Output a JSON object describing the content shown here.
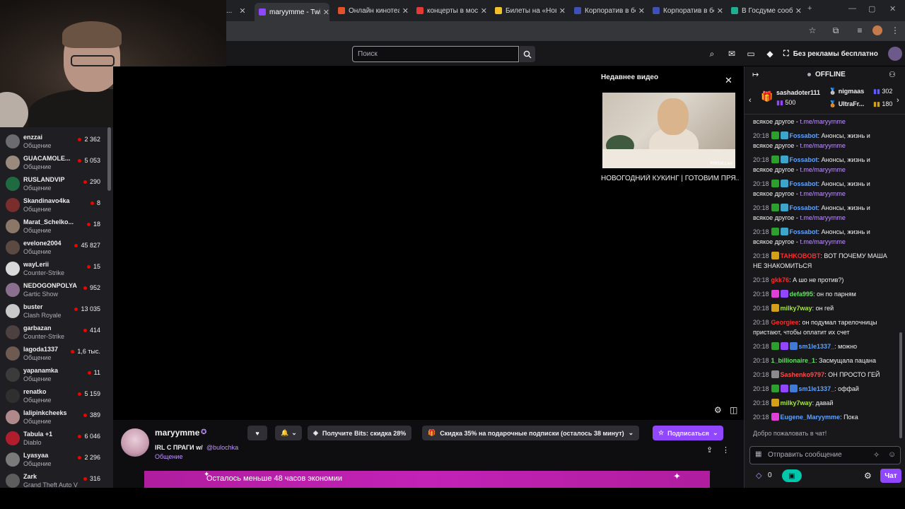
{
  "browser": {
    "tabs": [
      {
        "label": "...",
        "color": "#6f6f6f",
        "active": false
      },
      {
        "label": "maryymme - Twitch",
        "color": "#9147ff",
        "active": true
      },
      {
        "label": "Онлайн кинотеатр",
        "color": "#e2512a",
        "active": false
      },
      {
        "label": "концерты в моск",
        "color": "#e53935",
        "active": false
      },
      {
        "label": "Билеты на «Нова",
        "color": "#f2c029",
        "active": false
      },
      {
        "label": "Корпоратив в бе",
        "color": "#3f51b5",
        "active": false
      },
      {
        "label": "Корпоратив в бе",
        "color": "#3f51b5",
        "active": false
      },
      {
        "label": "В Госдуме сообщ",
        "color": "#1fae8f",
        "active": false
      }
    ],
    "new_tab": "+",
    "window_buttons": [
      "—",
      "▢",
      "✕"
    ]
  },
  "twitch_top": {
    "search_placeholder": "Поиск",
    "no_ads": "Без рекламы бесплатно"
  },
  "sidebar": {
    "channels": [
      {
        "name": "enzzai",
        "category": "Общение",
        "viewers": "2 362",
        "color": "#6b6b70"
      },
      {
        "name": "GUACAMOLE...",
        "category": "Общение",
        "viewers": "5 053",
        "color": "#9a8a7d"
      },
      {
        "name": "RUSLANDVIP",
        "category": "Общение",
        "viewers": "290",
        "color": "#1f6b41"
      },
      {
        "name": "Skandinavo4ka",
        "category": "Общение",
        "viewers": "8",
        "color": "#7a2d2d"
      },
      {
        "name": "Marat_Schelko...",
        "category": "Общение",
        "viewers": "18",
        "color": "#8a7768"
      },
      {
        "name": "evelone2004",
        "category": "Общение",
        "viewers": "45 827",
        "color": "#5a4a42"
      },
      {
        "name": "wayLerii",
        "category": "Counter-Strike",
        "viewers": "15",
        "color": "#d9d9d9"
      },
      {
        "name": "NEDOGONPOLYA",
        "category": "Gartic Show",
        "viewers": "952",
        "color": "#8a6f8f"
      },
      {
        "name": "buster",
        "category": "Clash Royale",
        "viewers": "13 035",
        "color": "#c9c9c9"
      },
      {
        "name": "garbazan",
        "category": "Counter-Strike",
        "viewers": "414",
        "color": "#4c4040"
      },
      {
        "name": "lagoda1337",
        "category": "Общение",
        "viewers": "1,6 тыс.",
        "color": "#6d5a50"
      },
      {
        "name": "yapanamka",
        "category": "Общение",
        "viewers": "11",
        "color": "#3b3b3b"
      },
      {
        "name": "renatko",
        "category": "Общение",
        "viewers": "5 159",
        "color": "#2f2f2f"
      },
      {
        "name": "lalipinkcheeks",
        "category": "Общение",
        "viewers": "389",
        "color": "#b08a8a"
      },
      {
        "name": "Tabula +1",
        "category": "Diablo",
        "viewers": "6 046",
        "color": "#b01d2d"
      },
      {
        "name": "Lyasyaa",
        "category": "Общение",
        "viewers": "2 296",
        "color": "#7a7a7a"
      },
      {
        "name": "Zark",
        "category": "Grand Theft Auto V",
        "viewers": "316",
        "color": "#5d5d5d"
      }
    ]
  },
  "recent": {
    "title": "Недавнее видео",
    "caption": "НОВОГОДНИЙ КУКИНГ | ГОТОВИМ ПРЯ...",
    "thumb_tag": "PRISM Live"
  },
  "channel": {
    "name": "maryymme",
    "title": "IRL С ПРАГИ w/",
    "mention": "@bulochka",
    "category": "Общение",
    "bits": "Получите Bits: скидка 28%",
    "gift": "Скидка 35% на подарочные подписки (осталось 38 минут)",
    "subscribe": "Подписаться",
    "promo": "Осталось меньше 48 часов экономии"
  },
  "chat": {
    "status": "OFFLINE",
    "gifter_name": "sashadoter111",
    "gifter_count": "500",
    "top1_name": "nigmaas",
    "top1_val": "302",
    "top2_name": "UltraFr...",
    "top2_val": "180",
    "messages": [
      {
        "ts": "",
        "user": "",
        "color": "#efeff1",
        "text": "всякое другое - ",
        "link": "t.me/maryymme",
        "badges": []
      },
      {
        "ts": "20:18",
        "user": "Fossabot",
        "color": "#5fa3ff",
        "text": ": Анонсы, жизнь и всякое другое - ",
        "link": "t.me/maryymme",
        "badges": [
          "#2ca02c",
          "#3fa4c9"
        ]
      },
      {
        "ts": "20:18",
        "user": "Fossabot",
        "color": "#5fa3ff",
        "text": ": Анонсы, жизнь и всякое другое - ",
        "link": "t.me/maryymme",
        "badges": [
          "#2ca02c",
          "#3fa4c9"
        ]
      },
      {
        "ts": "20:18",
        "user": "Fossabot",
        "color": "#5fa3ff",
        "text": ": Анонсы, жизнь и всякое другое - ",
        "link": "t.me/maryymme",
        "badges": [
          "#2ca02c",
          "#3fa4c9"
        ]
      },
      {
        "ts": "20:18",
        "user": "Fossabot",
        "color": "#5fa3ff",
        "text": ": Анонсы, жизнь и всякое другое - ",
        "link": "t.me/maryymme",
        "badges": [
          "#2ca02c",
          "#3fa4c9"
        ]
      },
      {
        "ts": "20:18",
        "user": "Fossabot",
        "color": "#5fa3ff",
        "text": ": Анонсы, жизнь и всякое другое - ",
        "link": "t.me/maryymme",
        "badges": [
          "#2ca02c",
          "#3fa4c9"
        ]
      },
      {
        "ts": "20:18",
        "user": "TAHKOBOBT",
        "color": "#ff2b2b",
        "text": ": ВОТ ПОЧЕМУ МАША НЕ ЗНАКОМИТЬСЯ",
        "link": "",
        "badges": [
          "#d4a017"
        ]
      },
      {
        "ts": "20:18",
        "user": "gkk76",
        "color": "#ff2b2b",
        "text": ": А шо не против?)",
        "link": "",
        "badges": []
      },
      {
        "ts": "20:18",
        "user": "defa995",
        "color": "#5fe35f",
        "text": ": он по парням",
        "link": "",
        "badges": [
          "#e03fd8",
          "#9147ff"
        ]
      },
      {
        "ts": "20:18",
        "user": "milky7way",
        "color": "#a8e34a",
        "text": ": он гей",
        "link": "",
        "badges": [
          "#d4a017"
        ]
      },
      {
        "ts": "20:18",
        "user": "Georgiee",
        "color": "#ff2b2b",
        "text": ": он подумал тарелочницы пристают, чтобы оплатит их счет",
        "link": "",
        "badges": []
      },
      {
        "ts": "20:18",
        "user": "sm1le1337_",
        "color": "#5fa3ff",
        "text": ": можно",
        "link": "",
        "badges": [
          "#2ca02c",
          "#9147ff",
          "#3f7bd6"
        ]
      },
      {
        "ts": "20:18",
        "user": "1_billionaire_1",
        "color": "#5fe35f",
        "text": ": Засмущала пацана",
        "link": "",
        "badges": []
      },
      {
        "ts": "20:18",
        "user": "Sashenko9797",
        "color": "#ff4a4a",
        "text": ": ОН ПРОСТО ГЕЙ",
        "link": "",
        "badges": [
          "#8a8a8a"
        ]
      },
      {
        "ts": "20:18",
        "user": "sm1le1337_",
        "color": "#5fa3ff",
        "text": ": оффай",
        "link": "",
        "badges": [
          "#2ca02c",
          "#9147ff",
          "#3f7bd6"
        ]
      },
      {
        "ts": "20:18",
        "user": "milky7way",
        "color": "#a8e34a",
        "text": ": давай",
        "link": "",
        "badges": [
          "#d4a017"
        ]
      },
      {
        "ts": "20:18",
        "user": "Eugene_Maryymme",
        "color": "#5fa3ff",
        "text": ": Пока",
        "link": "",
        "badges": [
          "#e03fd8"
        ]
      }
    ],
    "welcome": "Добро пожаловать в чат!",
    "input_placeholder": "Отправить сообщение",
    "points": "0",
    "send": "Чат"
  }
}
